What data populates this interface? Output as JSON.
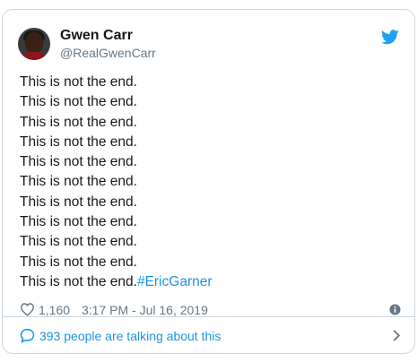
{
  "tweet": {
    "author_name": "Gwen Carr",
    "author_handle": "@RealGwenCarr",
    "lines": [
      "This is not the end.",
      "This is not the end.",
      "This is not the end.",
      "This is not the end.",
      "This is not the end.",
      "This is not the end.",
      "This is not the end.",
      "This is not the end.",
      "This is not the end.",
      "This is not the end.",
      "This is not the end."
    ],
    "hashtag": "#EricGarner",
    "likes": "1,160",
    "timestamp": "3:17 PM - Jul 16, 2019",
    "talking": "393 people are talking about this"
  },
  "colors": {
    "accent": "#1b95e0",
    "twitter_blue": "#1da1f2",
    "muted": "#657786",
    "border": "#ccd6dd"
  },
  "icons": {
    "brand": "twitter-bird-icon",
    "like": "heart-icon",
    "info": "info-icon",
    "reply": "speech-bubble-icon",
    "more": "chevron-right-icon"
  }
}
